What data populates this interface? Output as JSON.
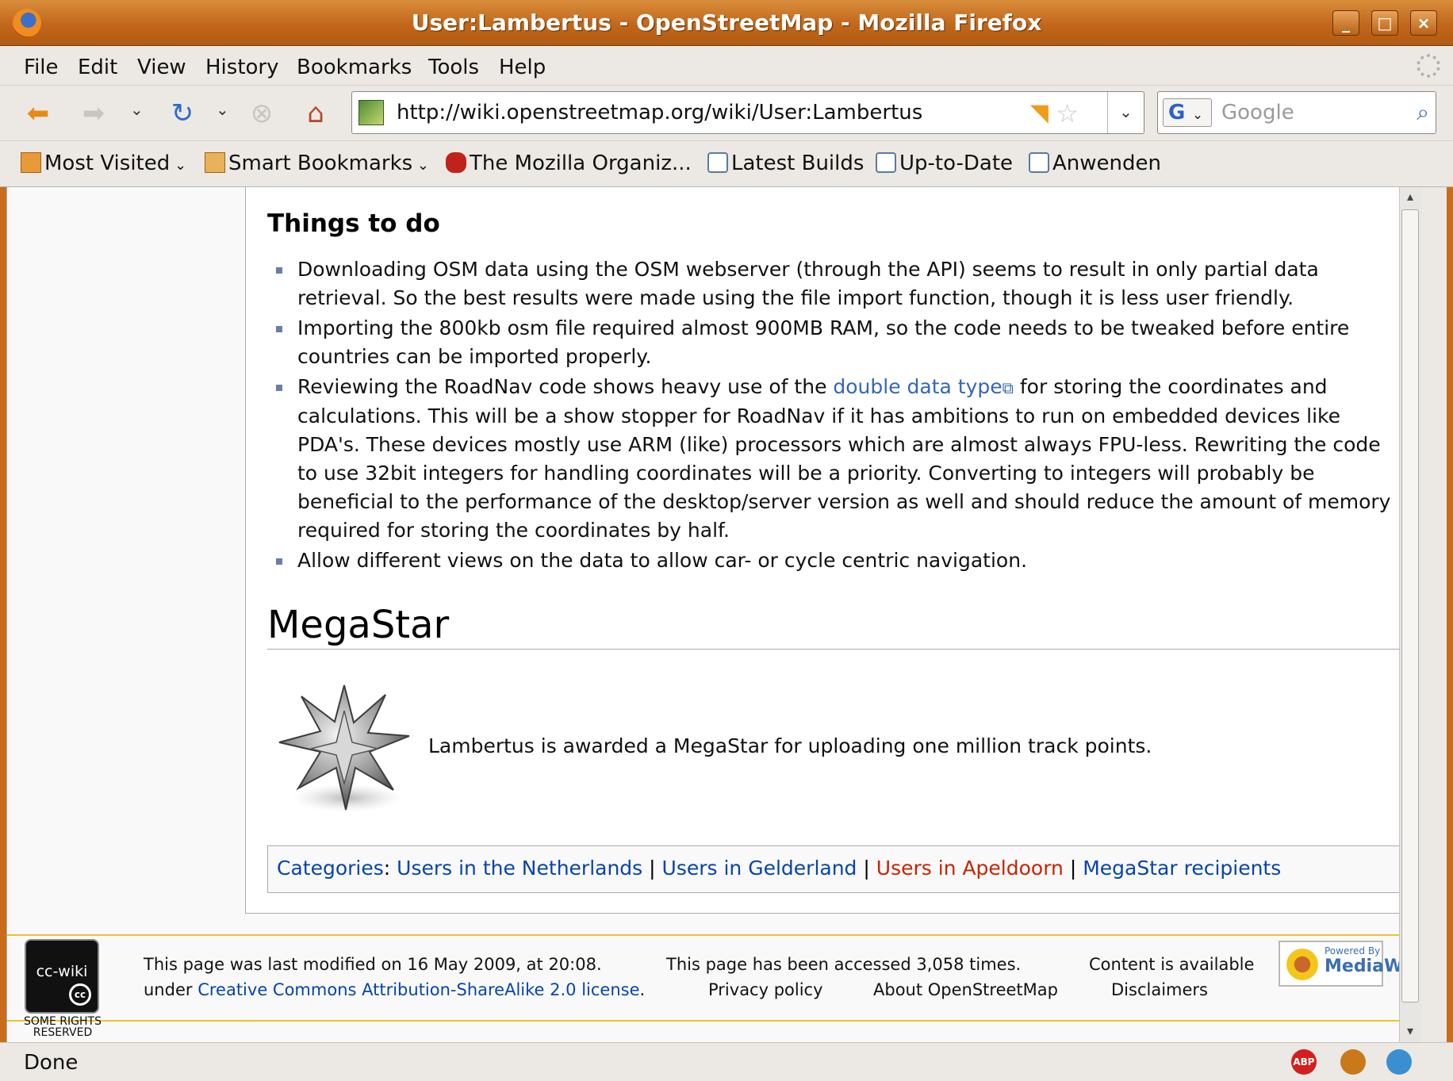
{
  "window": {
    "title": "User:Lambertus - OpenStreetMap - Mozilla Firefox",
    "controls": {
      "minimize": "_",
      "maximize": "□",
      "close": "×"
    }
  },
  "menu": {
    "items": [
      {
        "label": "File"
      },
      {
        "label": "Edit"
      },
      {
        "label": "View"
      },
      {
        "label": "History"
      },
      {
        "label": "Bookmarks"
      },
      {
        "label": "Tools"
      },
      {
        "label": "Help"
      }
    ]
  },
  "navbar": {
    "url": "http://wiki.openstreetmap.org/wiki/User:Lambertus",
    "search_engine": "G",
    "search_placeholder": "Google"
  },
  "bookmarks": {
    "items": [
      {
        "label": "Most Visited",
        "icon": "folder-icon",
        "has_dropdown": true
      },
      {
        "label": "Smart Bookmarks",
        "icon": "folder-icon",
        "has_dropdown": true
      },
      {
        "label": "The Mozilla Organiz...",
        "icon": "mozilla-icon"
      },
      {
        "label": "Latest Builds",
        "icon": "livemark-icon"
      },
      {
        "label": "Up-to-Date",
        "icon": "livemark-icon"
      },
      {
        "label": "Anwenden",
        "icon": "livemark-icon"
      }
    ]
  },
  "article": {
    "things_heading": "Things to do",
    "todo": [
      {
        "text": "Downloading OSM data using the OSM webserver (through the API) seems to result in only partial data retrieval. So the best results were made using the file import function, though it is less user friendly."
      },
      {
        "text": "Importing the 800kb osm file required almost 900MB RAM, so the code needs to be tweaked before entire countries can be imported properly."
      },
      {
        "pre": "Reviewing the RoadNav code shows heavy use of the ",
        "link": "double data type",
        "post": " for storing the coordinates and calculations. This will be a show stopper for RoadNav if it has ambitions to run on embedded devices like PDA's. These devices mostly use ARM (like) processors which are almost always FPU-less. Rewriting the code to use 32bit integers for handling coordinates will be a priority. Converting to integers will probably be beneficial to the performance of the desktop/server version as well and should reduce the amount of memory required for storing the coordinates by half."
      },
      {
        "text": "Allow different views on the data to allow car- or cycle centric navigation."
      }
    ],
    "megastar_heading": "MegaStar",
    "award_text": "Lambertus is awarded a MegaStar for uploading one million track points.",
    "categories_label": "Categories",
    "categories": [
      {
        "label": "Users in the Netherlands",
        "color": "#0645ad"
      },
      {
        "label": "Users in Gelderland",
        "color": "#0645ad"
      },
      {
        "label": "Users in Apeldoorn",
        "color": "#cc2200"
      },
      {
        "label": "MegaStar recipients",
        "color": "#0645ad"
      }
    ]
  },
  "footer": {
    "cc_badge": "cc-wiki",
    "cc_sub": "SOME RIGHTS RESERVED",
    "last_modified": "This page was last modified on 16 May 2009, at 20:08.",
    "accessed": "This page has been accessed 3,058 times.",
    "content_available": "Content is available",
    "under": "under",
    "license": "Creative Commons Attribution-ShareAlike 2.0 license",
    "privacy": "Privacy policy",
    "about": "About OpenStreetMap",
    "disclaimers": "Disclaimers",
    "powered_by": "Powered By",
    "mediawiki": "MediaWiki"
  },
  "status": {
    "text": "Done",
    "abp": "ABP"
  }
}
